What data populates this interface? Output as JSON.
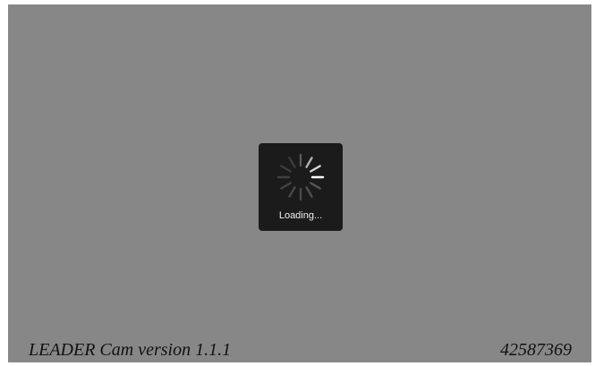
{
  "loading": {
    "label": "Loading...",
    "icon": "spinner-icon"
  },
  "footer": {
    "version": "LEADER Cam version 1.1.1",
    "id": "42587369"
  },
  "colors": {
    "screen_background": "#878787",
    "panel_background": "#1b1b1b",
    "spinner_active": "#ffffff",
    "text_dark": "#111111"
  }
}
